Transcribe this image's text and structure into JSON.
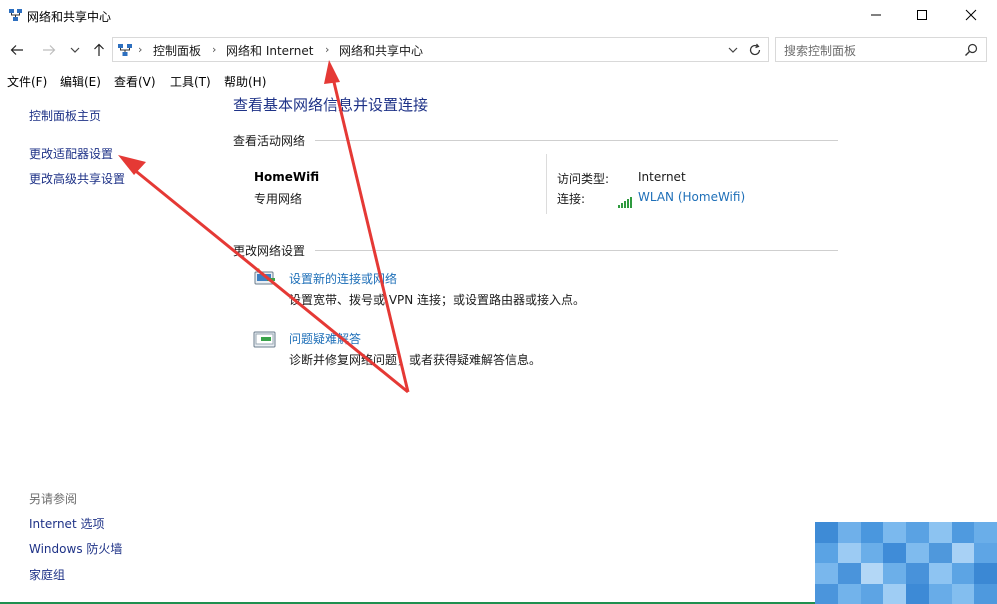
{
  "window": {
    "title": "网络和共享中心",
    "minimize_glyph": "—",
    "maximize_glyph": "☐",
    "close_glyph": "✕"
  },
  "nav": {
    "back_glyph": "←",
    "forward_glyph": "→",
    "recent_glyph": "⌄",
    "up_glyph": "↑",
    "breadcrumbs": [
      "控制面板",
      "网络和 Internet",
      "网络和共享中心"
    ],
    "separator": "›",
    "dropdown_glyph": "⌄",
    "refresh_glyph": "↻"
  },
  "search": {
    "placeholder": "搜索控制面板"
  },
  "menu": {
    "items": [
      "文件(F)",
      "编辑(E)",
      "查看(V)",
      "工具(T)",
      "帮助(H)"
    ]
  },
  "sidebar": {
    "links": [
      "控制面板主页",
      "更改适配器设置",
      "更改高级共享设置"
    ],
    "see_also_label": "另请参阅",
    "see_also_links": [
      "Internet 选项",
      "Windows 防火墙",
      "家庭组"
    ]
  },
  "main": {
    "title": "查看基本网络信息并设置连接",
    "active_networks_label": "查看活动网络",
    "network": {
      "name": "HomeWifi",
      "category": "专用网络",
      "access_type_label": "访问类型:",
      "access_type_value": "Internet",
      "connection_label": "连接:",
      "connection_value": "WLAN (HomeWifi)"
    },
    "change_settings_label": "更改网络设置",
    "tasks": [
      {
        "link": "设置新的连接或网络",
        "desc": "设置宽带、拨号或 VPN 连接；或设置路由器或接入点。"
      },
      {
        "link": "问题疑难解答",
        "desc": "诊断并修复网络问题，或者获得疑难解答信息。"
      }
    ]
  },
  "colors": {
    "link": "#1e3287",
    "link_light": "#1e6fb8",
    "annotation_arrow": "#e53935"
  }
}
